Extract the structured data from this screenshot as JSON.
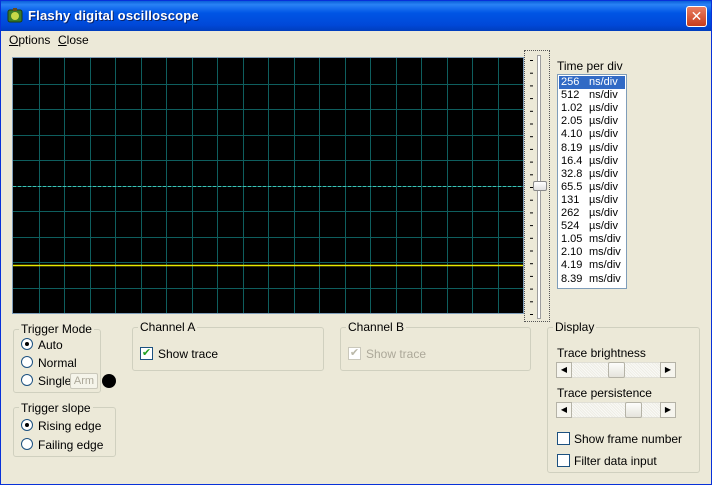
{
  "window": {
    "title": "Flashy digital oscilloscope",
    "close_glyph": "✕"
  },
  "menu": {
    "options": "Options",
    "options_mnemonic": "O",
    "options_rest": "ptions",
    "close_mnemonic": "C",
    "close_rest": "lose"
  },
  "scope": {
    "trace_color": "#e8e800",
    "grid_color": "#0e5e5e",
    "center_line_color": "#3fc4b4",
    "trace_level_fraction": 0.81
  },
  "time_per_div": {
    "label": "Time per div",
    "items": [
      {
        "value": "256",
        "unit": "ns/div"
      },
      {
        "value": "512",
        "unit": "ns/div"
      },
      {
        "value": "1.02",
        "unit": "µs/div"
      },
      {
        "value": "2.05",
        "unit": "µs/div"
      },
      {
        "value": "4.10",
        "unit": "µs/div"
      },
      {
        "value": "8.19",
        "unit": "µs/div"
      },
      {
        "value": "16.4",
        "unit": "µs/div"
      },
      {
        "value": "32.8",
        "unit": "µs/div"
      },
      {
        "value": "65.5",
        "unit": "µs/div"
      },
      {
        "value": "131",
        "unit": "µs/div"
      },
      {
        "value": "262",
        "unit": "µs/div"
      },
      {
        "value": "524",
        "unit": "µs/div"
      },
      {
        "value": "1.05",
        "unit": "ms/div"
      },
      {
        "value": "2.10",
        "unit": "ms/div"
      },
      {
        "value": "4.19",
        "unit": "ms/div"
      },
      {
        "value": "8.39",
        "unit": "ms/div"
      }
    ],
    "selected": "256"
  },
  "trigger_mode": {
    "title": "Trigger Mode",
    "auto": "Auto",
    "normal": "Normal",
    "single": "Single",
    "arm": "Arm",
    "selected": "Auto"
  },
  "trigger_slope": {
    "title": "Trigger slope",
    "rising": "Rising edge",
    "falling": "Failing edge",
    "selected": "Rising edge"
  },
  "channel_a": {
    "title": "Channel A",
    "show_trace": "Show trace",
    "checked": true
  },
  "channel_b": {
    "title": "Channel B",
    "show_trace": "Show trace",
    "checked": true,
    "disabled": true
  },
  "display": {
    "title": "Display",
    "brightness_label": "Trace brightness",
    "brightness_level": 0.5,
    "persistence_label": "Trace persistence",
    "persistence_level": 0.75,
    "show_frame_number": "Show frame number",
    "filter_data_input": "Filter data input"
  }
}
